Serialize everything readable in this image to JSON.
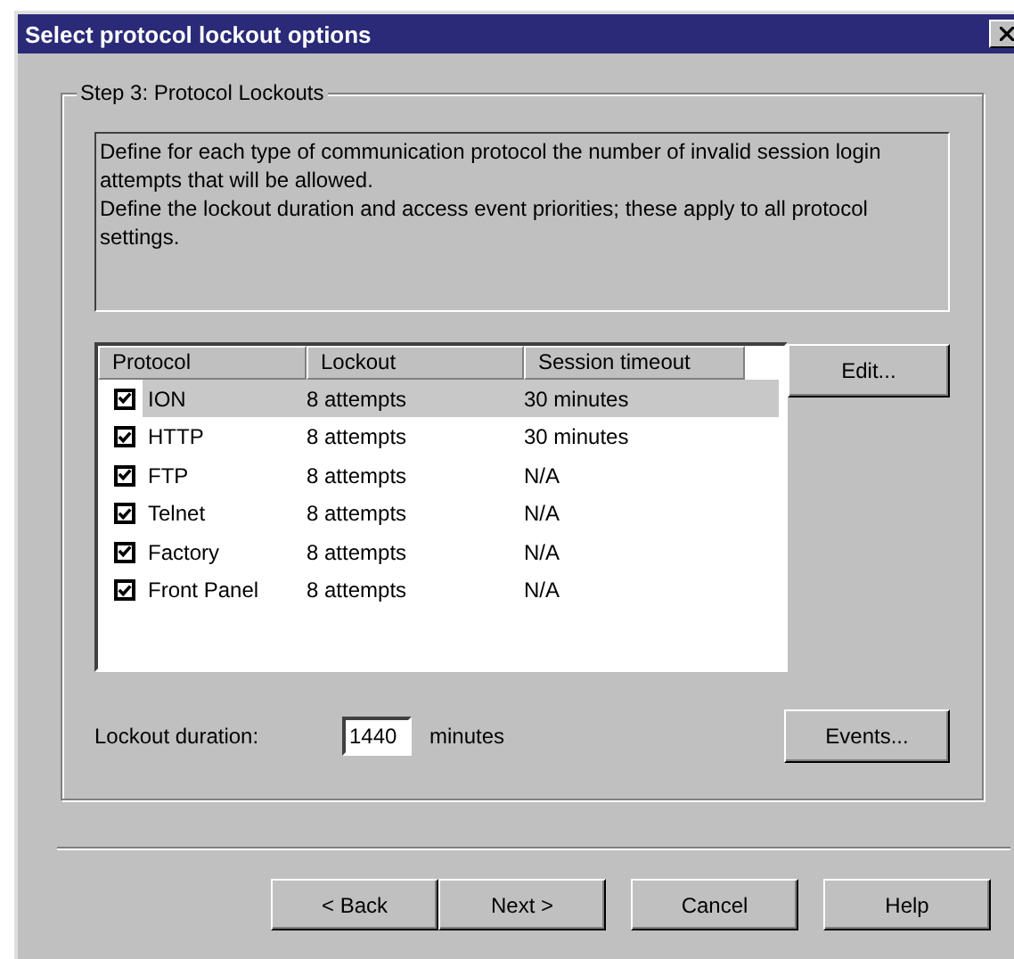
{
  "window": {
    "title": "Select protocol lockout options"
  },
  "group": {
    "title": "Step 3: Protocol Lockouts",
    "description": [
      "Define for each type of communication protocol the number of invalid session login attempts that will be allowed.",
      "Define the lockout duration and access event priorities; these apply to all protocol settings."
    ]
  },
  "table": {
    "columns": [
      "Protocol",
      "Lockout",
      "Session timeout"
    ],
    "rows": [
      {
        "protocol": "ION",
        "lockout": "8 attempts",
        "timeout": "30 minutes",
        "checked": true,
        "selected": true
      },
      {
        "protocol": "HTTP",
        "lockout": "8 attempts",
        "timeout": "30 minutes",
        "checked": true,
        "selected": false
      },
      {
        "protocol": "FTP",
        "lockout": "8 attempts",
        "timeout": "N/A",
        "checked": true,
        "selected": false
      },
      {
        "protocol": "Telnet",
        "lockout": "8 attempts",
        "timeout": "N/A",
        "checked": true,
        "selected": false
      },
      {
        "protocol": "Factory",
        "lockout": "8 attempts",
        "timeout": "N/A",
        "checked": true,
        "selected": false
      },
      {
        "protocol": "Front Panel",
        "lockout": "8 attempts",
        "timeout": "N/A",
        "checked": true,
        "selected": false
      }
    ]
  },
  "edit_button": "Edit...",
  "lockout_duration": {
    "label": "Lockout duration:",
    "value": "1440",
    "unit": "minutes"
  },
  "events_button": "Events...",
  "buttons": [
    "< Back",
    "Next >",
    "Cancel",
    "Help"
  ]
}
